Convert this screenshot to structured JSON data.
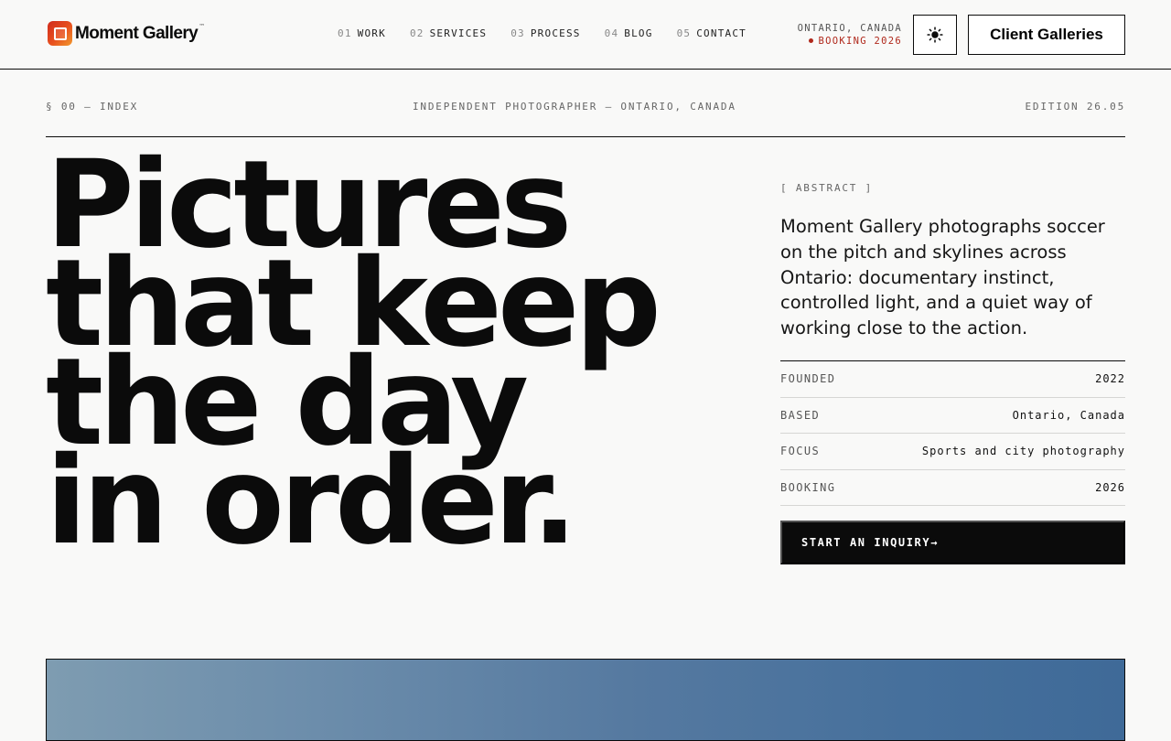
{
  "brand": {
    "name": "Moment Gallery",
    "tm": "™",
    "accent": "#b0281b",
    "logo_gradient": [
      "#d02a1c",
      "#f29a2e"
    ]
  },
  "nav": [
    {
      "num": "01",
      "label": "WORK"
    },
    {
      "num": "02",
      "label": "SERVICES"
    },
    {
      "num": "03",
      "label": "PROCESS"
    },
    {
      "num": "04",
      "label": "BLOG"
    },
    {
      "num": "05",
      "label": "CONTACT"
    }
  ],
  "header": {
    "location": "ONTARIO, CANADA",
    "booking_status": "BOOKING 2026",
    "theme_icon": "sun-icon",
    "client_button": "Client Galleries"
  },
  "strip": {
    "index": "§ 00 — INDEX",
    "center": "INDEPENDENT PHOTOGRAPHER — ONTARIO, CANADA",
    "edition": "EDITION 26.05"
  },
  "headline": [
    "Pictures",
    "that keep",
    "the day",
    "in order."
  ],
  "abstract": {
    "tag": "[ ABSTRACT ]",
    "text": "Moment Gallery photographs soccer on the pitch and skylines across Ontario: documentary instinct, controlled light, and a quiet way of working close to the action."
  },
  "facts": [
    {
      "label": "FOUNDED",
      "value": "2022"
    },
    {
      "label": "BASED",
      "value": "Ontario, Canada"
    },
    {
      "label": "FOCUS",
      "value": "Sports and city photography"
    },
    {
      "label": "BOOKING",
      "value": "2026"
    }
  ],
  "cta": {
    "label": "START AN INQUIRY",
    "arrow": "→"
  }
}
